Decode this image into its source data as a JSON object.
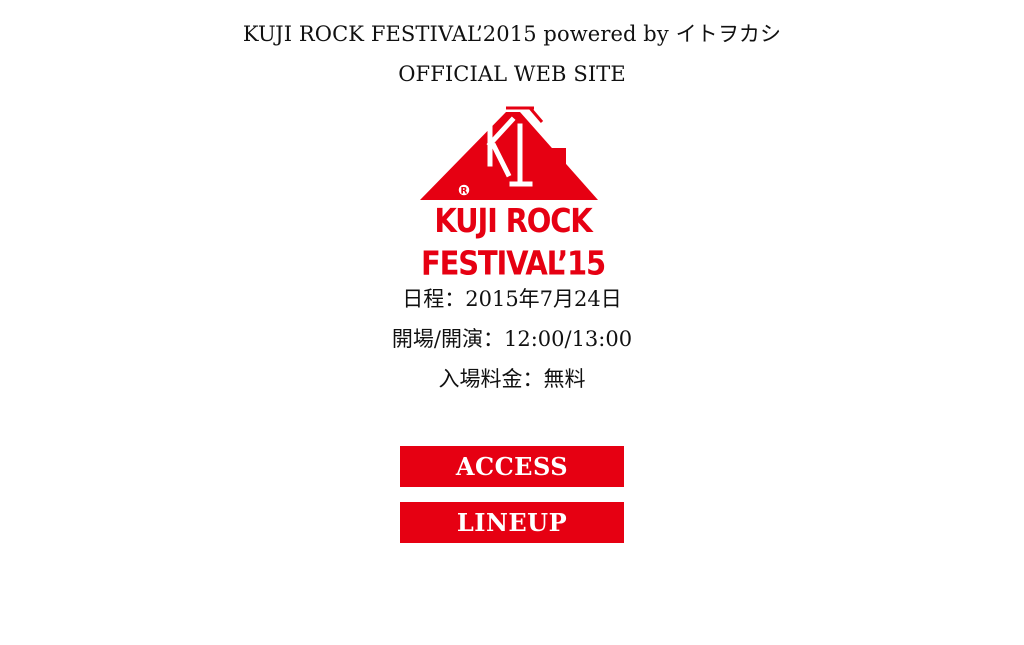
{
  "header": {
    "line1": "KUJI ROCK FESTIVAL’2015 powered by イトヲカシ",
    "line2": "OFFICIAL WEB SITE"
  },
  "logo": {
    "text": "KUJI ROCK FESTIVAL’15",
    "registered_mark": "R"
  },
  "event_info": {
    "date": "日程：2015年7月24日",
    "time": "開場/開演：12:00/13:00",
    "admission": "入場料金：無料"
  },
  "buttons": {
    "access": "ACCESS",
    "lineup": "LINEUP"
  },
  "colors": {
    "brand_red": "#e60012",
    "text": "#111111",
    "background": "#ffffff"
  }
}
